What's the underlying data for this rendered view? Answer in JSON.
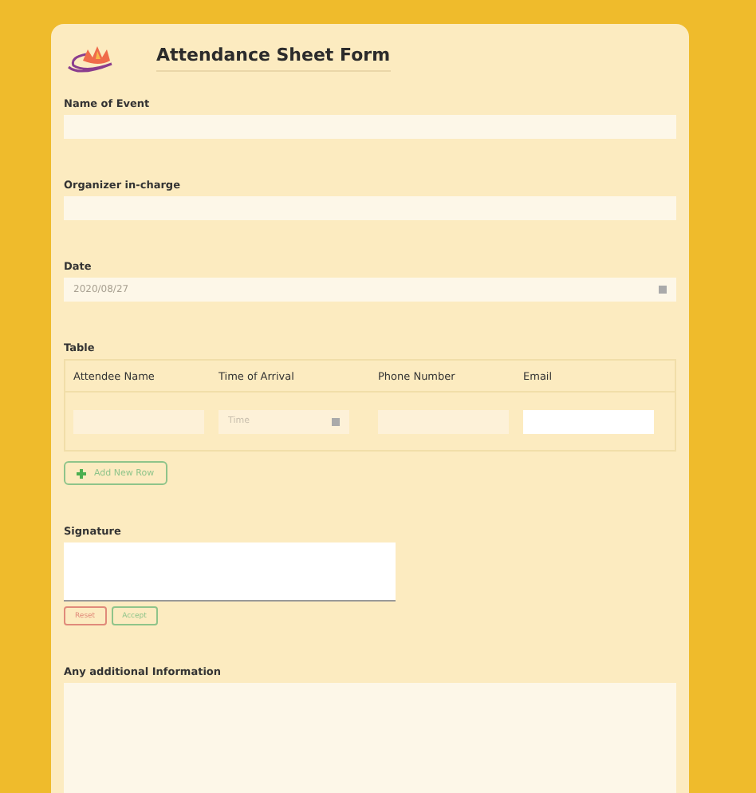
{
  "form": {
    "title": "Attendance Sheet Form",
    "fields": [
      {
        "kind": "text",
        "label": "Name of Event"
      },
      {
        "kind": "text",
        "label": "Organizer in-charge"
      },
      {
        "kind": "date",
        "label": "Date",
        "value": "2020/08/27"
      },
      {
        "kind": "table",
        "label": "Table",
        "columns": [
          "Attendee Name",
          "Time of Arrival",
          "Phone Number",
          "Email"
        ],
        "row": [
          {
            "kind": "text"
          },
          {
            "kind": "time",
            "placeholder": "Time"
          },
          {
            "kind": "text"
          },
          {
            "kind": "email"
          }
        ],
        "add_button": "Add New Row"
      },
      {
        "kind": "signature",
        "label": "Signature",
        "buttons": [
          "Reset",
          "Accept"
        ]
      },
      {
        "kind": "textarea",
        "label": "Any additional Information"
      }
    ]
  }
}
